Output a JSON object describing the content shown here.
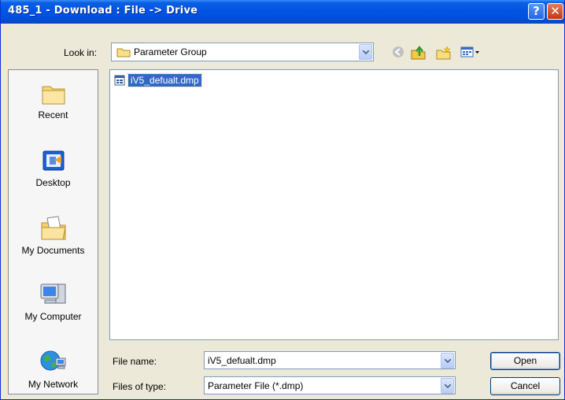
{
  "window": {
    "title": "485_1 - Download : File -> Drive"
  },
  "titlebar": {
    "help_glyph": "?",
    "close_glyph": "✕"
  },
  "toolbar": {
    "look_in_label": "Look in:",
    "look_in_value": "Parameter Group",
    "icons": [
      "back-icon",
      "up-folder-icon",
      "new-folder-icon",
      "view-menu-icon"
    ]
  },
  "places": [
    {
      "label": "Recent",
      "icon": "recent-folder-icon"
    },
    {
      "label": "Desktop",
      "icon": "desktop-icon"
    },
    {
      "label": "My Documents",
      "icon": "my-documents-icon"
    },
    {
      "label": "My Computer",
      "icon": "my-computer-icon"
    },
    {
      "label": "My Network",
      "icon": "my-network-icon"
    }
  ],
  "files": [
    {
      "name": "iV5_defualt.dmp",
      "selected": true
    }
  ],
  "form": {
    "file_name_label": "File name:",
    "file_name_value": "iV5_defualt.dmp",
    "file_type_label": "Files of type:",
    "file_type_value": "Parameter File (*.dmp)"
  },
  "buttons": {
    "open": "Open",
    "cancel": "Cancel"
  },
  "colors": {
    "title_blue": "#0054e3",
    "selection": "#316ac5",
    "dialog_bg": "#ece9d8"
  }
}
